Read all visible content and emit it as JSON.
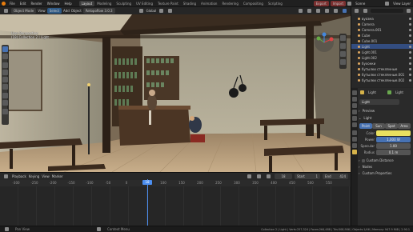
{
  "topbar": {
    "menus": [
      "File",
      "Edit",
      "Render",
      "Window",
      "Help"
    ],
    "workspaces": [
      "Layout",
      "Modeling",
      "Sculpting",
      "UV Editing",
      "Texture Paint",
      "Shading",
      "Animation",
      "Rendering",
      "Compositing",
      "Scripting"
    ],
    "active_workspace": "Layout",
    "export_label": "Export",
    "import_label": "Import",
    "scene_label": "Scene",
    "view_layer_label": "View Layer"
  },
  "viewport_header": {
    "mode": "Object Mode",
    "menus": [
      "View",
      "Select",
      "Add",
      "Object"
    ],
    "addon": "Retopoflow 3.0.3",
    "orientation": "Global"
  },
  "overlay": {
    "view_name": "User Perspective",
    "collection": "(18) Collection 2 | Light"
  },
  "outliner": {
    "items": [
      {
        "name": "вуозма",
        "selected": false
      },
      {
        "name": "Camera",
        "selected": false
      },
      {
        "name": "Camera.001",
        "selected": false
      },
      {
        "name": "Cube",
        "selected": false
      },
      {
        "name": "Cube.001",
        "selected": false
      },
      {
        "name": "Light",
        "selected": true
      },
      {
        "name": "Light.001",
        "selected": false
      },
      {
        "name": "Light.002",
        "selected": false
      },
      {
        "name": "бухонки",
        "selected": false
      },
      {
        "name": "бутылки стеклянные",
        "selected": false
      },
      {
        "name": "бутылки стеклянные.001",
        "selected": false
      },
      {
        "name": "бутылки стеклянные.002",
        "selected": false
      }
    ]
  },
  "properties": {
    "breadcrumb_obj": "Light",
    "breadcrumb_data": "Light",
    "datablock": "Light",
    "preview": "Preview",
    "section": "Light",
    "types": [
      "Point",
      "Sun",
      "Spot",
      "Area"
    ],
    "active_type": "Point",
    "color_label": "Color",
    "power_label": "Power",
    "power_value": "1,000 W",
    "specular_label": "Specular",
    "specular_value": "1.00",
    "radius_label": "Radius",
    "radius_value": "0.1 m",
    "custom_distance": "Custom Distance",
    "nodes": "Nodes",
    "custom_props": "Custom Properties",
    "light_color": "#e8e060"
  },
  "timeline": {
    "menus": [
      "Playback",
      "Keying",
      "View",
      "Marker"
    ],
    "current_frame": "18",
    "start_label": "Start",
    "start_value": "1",
    "end_label": "End",
    "end_value": "424",
    "ticks": [
      "-300",
      "-250",
      "-200",
      "-150",
      "-100",
      "-50",
      "0",
      "50",
      "100",
      "150",
      "200",
      "250",
      "300",
      "350",
      "400",
      "450",
      "500",
      "550"
    ]
  },
  "statusbar": {
    "hint1": "Pan View",
    "hint2": "Context Menu",
    "stats": "Collection 2 | Light | Verts:257,324 | Faces:264,488 | Tris:508,906 | Objects:1/46 | Memory: 947.9 MiB | 2.90.1"
  }
}
